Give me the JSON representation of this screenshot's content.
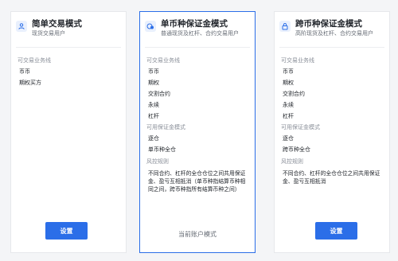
{
  "cards": [
    {
      "title": "简单交易模式",
      "subtitle": "现货交易用户",
      "icon": "user-icon",
      "business_label": "可交易业务线",
      "business_items": [
        "币币",
        "期权买方"
      ],
      "button_label": "设置"
    },
    {
      "title": "单币种保证金模式",
      "subtitle": "普通现货及杠杆、合约交易用户",
      "icon": "coin-icon",
      "business_label": "可交易业务线",
      "business_items": [
        "币币",
        "期权",
        "交割合约",
        "永续",
        "杠杆"
      ],
      "margin_label": "可用保证金模式",
      "margin_items": [
        "逐仓",
        "单币种全仓"
      ],
      "risk_label": "风控规则",
      "risk_text": "不同合约、杠杆的全仓仓位之间共用保证金、盈亏互相抵消（单币种指结算币种相同之间，跨币种指所有结算币种之间）",
      "status_text": "当前账户模式"
    },
    {
      "title": "跨币种保证金模式",
      "subtitle": "高阶现货及杠杆、合约交易用户",
      "icon": "lock-icon",
      "business_label": "可交易业务线",
      "business_items": [
        "币币",
        "期权",
        "交割合约",
        "永续",
        "杠杆"
      ],
      "margin_label": "可用保证金模式",
      "margin_items": [
        "逐仓",
        "跨币种全仓"
      ],
      "risk_label": "风控规则",
      "risk_text": "不同合约、杠杆的全仓仓位之间共用保证金、盈亏互相抵消",
      "button_label": "设置"
    }
  ],
  "colors": {
    "accent": "#2b6ee8",
    "selected_border": "#2b6ee8",
    "muted_text": "#8a8f99"
  }
}
